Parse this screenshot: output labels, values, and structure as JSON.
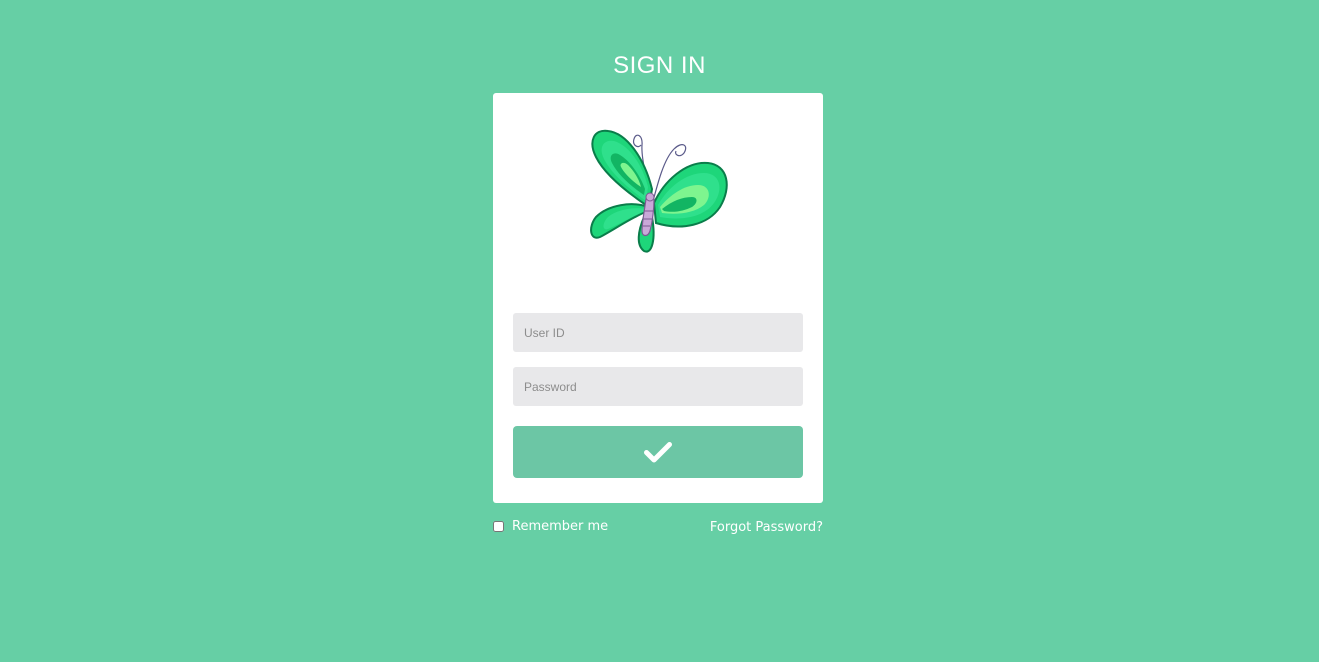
{
  "page": {
    "title": "SIGN IN",
    "background_color": "#66cfa5"
  },
  "login_card": {
    "logo_icon": "butterfly-icon",
    "user_field": {
      "placeholder": "User ID",
      "value": ""
    },
    "password_field": {
      "placeholder": "Password",
      "value": ""
    },
    "submit_button": {
      "icon": "checkmark-icon",
      "color": "#6cc6a5"
    }
  },
  "footer": {
    "remember_label": "Remember me",
    "remember_checked": false,
    "forgot_label": "Forgot Password?"
  }
}
